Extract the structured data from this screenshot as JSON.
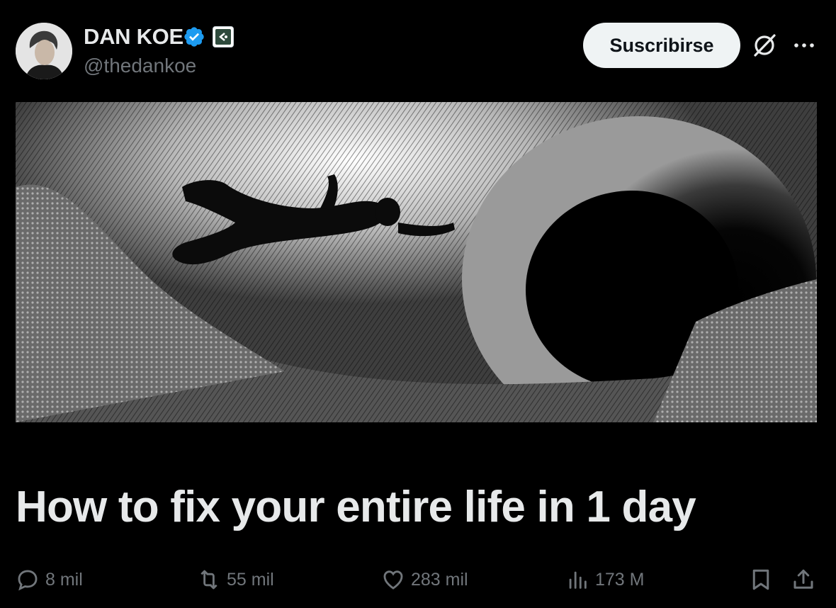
{
  "author": {
    "display_name": "DAN KOE",
    "handle": "@thedankoe"
  },
  "header": {
    "subscribe_label": "Suscribirse"
  },
  "article": {
    "title": "How to fix your entire life in 1 day"
  },
  "actions": {
    "replies": "8 mil",
    "reposts": "55 mil",
    "likes": "283 mil",
    "views": "173 M"
  },
  "colors": {
    "background": "#000000",
    "text_primary": "#e7e9ea",
    "text_secondary": "#71767b",
    "verified": "#1d9bf0",
    "button_bg": "#eff3f4"
  },
  "icons": [
    "verified-badge-icon",
    "affiliate-badge-icon",
    "grok-icon",
    "more-icon",
    "reply-icon",
    "repost-icon",
    "like-icon",
    "views-icon",
    "bookmark-icon",
    "share-icon"
  ]
}
